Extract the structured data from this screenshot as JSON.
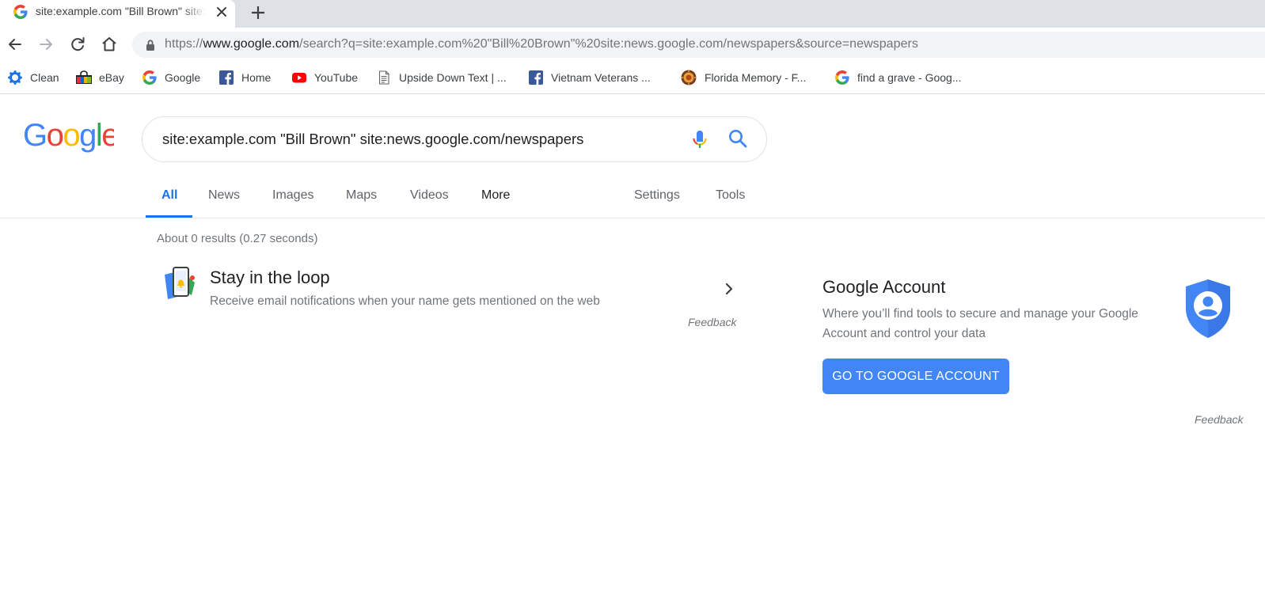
{
  "browser": {
    "tab": {
      "title": "site:example.com \"Bill Brown\" site:news.google.com/newspapers",
      "favicon": "google-g-icon",
      "close_icon": "close-icon"
    },
    "newtab_icon": "plus-icon",
    "url": {
      "prefix": "https://",
      "host": "www.google.com",
      "path": "/search?q=site:example.com%20\"Bill%20Brown\"%20site:news.google.com/newspapers&source=newspapers"
    },
    "bookmarks": [
      {
        "label": "Clean",
        "icon": "gear-icon"
      },
      {
        "label": "eBay",
        "icon": "shopping-bag-icon"
      },
      {
        "label": "Google",
        "icon": "google-g-icon"
      },
      {
        "label": "Home",
        "icon": "facebook-icon"
      },
      {
        "label": "YouTube",
        "icon": "youtube-icon"
      },
      {
        "label": "Upside Down Text | ...",
        "icon": "document-icon"
      },
      {
        "label": "Vietnam Veterans ...",
        "icon": "facebook-icon"
      },
      {
        "label": "Florida Memory - F...",
        "icon": "florida-seal-icon"
      },
      {
        "label": "find a grave - Goog...",
        "icon": "google-g-icon"
      }
    ]
  },
  "search": {
    "query": "site:example.com \"Bill Brown\" site:news.google.com/newspapers"
  },
  "tabs": {
    "all": "All",
    "news": "News",
    "images": "Images",
    "maps": "Maps",
    "videos": "Videos",
    "more": "More",
    "settings": "Settings",
    "tools": "Tools"
  },
  "results": {
    "stats": "About 0 results (0.27 seconds)",
    "loop": {
      "title": "Stay in the loop",
      "description": "Receive email notifications when your name gets mentioned on the web",
      "feedback": "Feedback"
    }
  },
  "account": {
    "title": "Google Account",
    "description": "Where you’ll find tools to secure and manage your Google Account and control your data",
    "button": "GO TO GOOGLE ACCOUNT",
    "feedback": "Feedback"
  },
  "colors": {
    "google_blue": "#4285f4",
    "google_red": "#ea4335",
    "google_yellow": "#fbbc05",
    "google_green": "#34a853",
    "link_blue": "#1a73e8"
  }
}
